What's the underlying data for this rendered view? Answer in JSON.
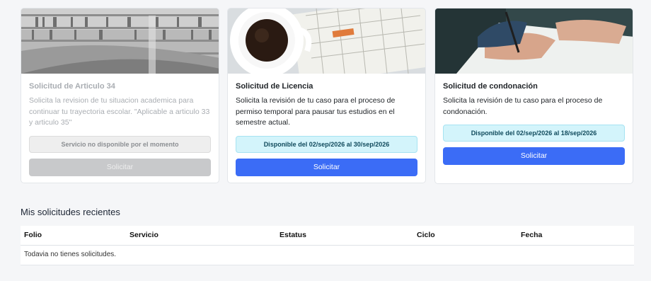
{
  "cards": [
    {
      "title": "Solicitud de Articulo 34",
      "description": "Solicita la revision de tu situacion academica para continuar tu trayectoria escolar. \"Aplicable a articulo 33 y articulo 35\"",
      "status": "Servicio no disponible por el momento",
      "button": "Solicitar",
      "image": "library-bookshelves-photo",
      "enabled": false
    },
    {
      "title": "Solicitud de Licencia",
      "description": "Solicita la revisión de tu caso para el proceso de permiso temporal para pausar tus estudios en el semestre actual.",
      "status": "Disponible del 02/sep/2026 al 30/sep/2026",
      "button": "Solicitar",
      "image": "coffee-and-calendar-photo",
      "enabled": true
    },
    {
      "title": "Solicitud de condonación",
      "description": "Solicita la revisión de tu caso para el proceso de condonación.",
      "status": "Disponible del 02/sep/2026 al 18/sep/2026",
      "button": "Solicitar",
      "image": "hand-signing-document-photo",
      "enabled": true
    }
  ],
  "recent": {
    "title": "Mis solicitudes recientes",
    "columns": [
      "Folio",
      "Servicio",
      "Estatus",
      "Ciclo",
      "Fecha"
    ],
    "empty_message": "Todavia no tienes solicitudes."
  },
  "colors": {
    "primary": "#3b6cf6",
    "info_bg": "#d3f4fb",
    "disabled": "#c8c9cb"
  }
}
